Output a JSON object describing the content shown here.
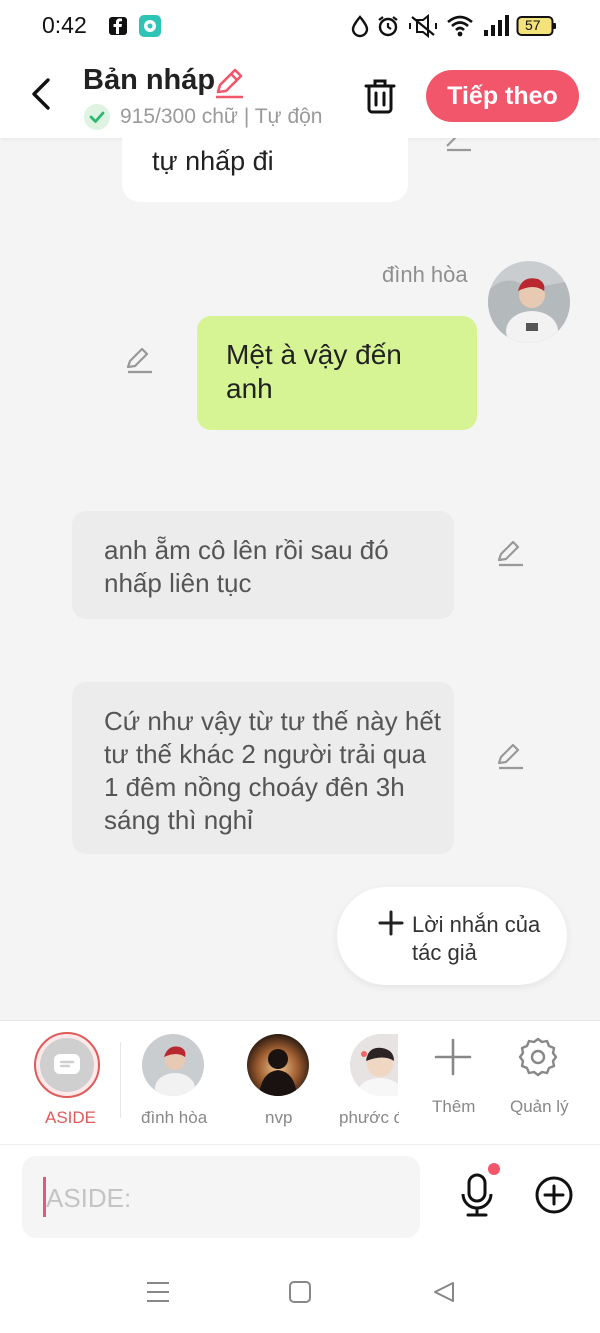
{
  "status_bar": {
    "time": "0:42",
    "battery": "57"
  },
  "header": {
    "title": "Bản nháp",
    "word_count": "915/300 chữ | Tự độn",
    "next_button": "Tiếp theo"
  },
  "messages": [
    {
      "text": "tự nhấp đi",
      "style": "white"
    },
    {
      "author": "đình hòa",
      "text": "Mệt à vậy đến anh",
      "style": "green"
    },
    {
      "text": "anh ẵm cô lên rồi sau đó nhấp liên tục",
      "style": "gray"
    },
    {
      "text": "Cứ như vậy từ tư thế này hết tư thế khác 2 người trải qua 1 đêm nồng choáy đên 3h sáng thì nghỉ",
      "style": "gray"
    }
  ],
  "author_note": {
    "label": "Lời nhắn của tác giả"
  },
  "characters": [
    {
      "label": "ASIDE",
      "selected": true
    },
    {
      "label": "đình hòa"
    },
    {
      "label": "nvp"
    },
    {
      "label": "phước đ"
    },
    {
      "label": "Thêm"
    },
    {
      "label": "Quản lý"
    }
  ],
  "input": {
    "placeholder": "ASIDE:"
  },
  "colors": {
    "accent": "#f2566a",
    "my_bubble": "#d7f495",
    "other_bubble": "#ececec"
  }
}
